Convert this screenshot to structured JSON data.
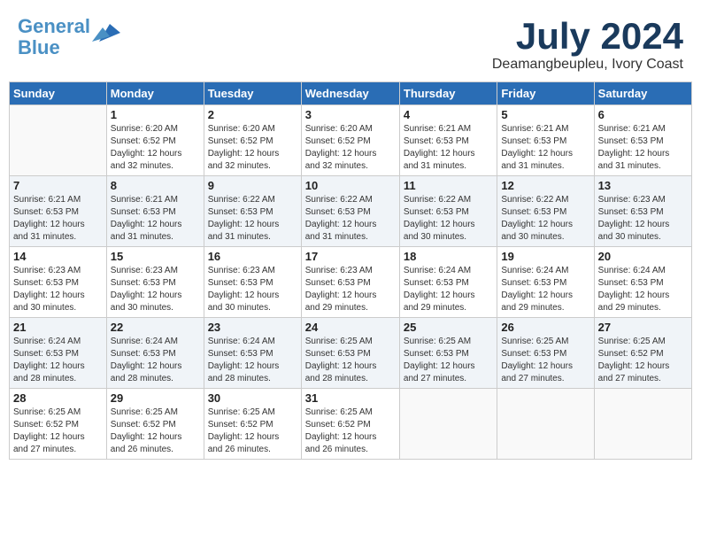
{
  "header": {
    "logo_line1": "General",
    "logo_line2": "Blue",
    "month": "July 2024",
    "location": "Deamangbeupleu, Ivory Coast"
  },
  "weekdays": [
    "Sunday",
    "Monday",
    "Tuesday",
    "Wednesday",
    "Thursday",
    "Friday",
    "Saturday"
  ],
  "weeks": [
    [
      {
        "day": "",
        "info": ""
      },
      {
        "day": "1",
        "info": "Sunrise: 6:20 AM\nSunset: 6:52 PM\nDaylight: 12 hours\nand 32 minutes."
      },
      {
        "day": "2",
        "info": "Sunrise: 6:20 AM\nSunset: 6:52 PM\nDaylight: 12 hours\nand 32 minutes."
      },
      {
        "day": "3",
        "info": "Sunrise: 6:20 AM\nSunset: 6:52 PM\nDaylight: 12 hours\nand 32 minutes."
      },
      {
        "day": "4",
        "info": "Sunrise: 6:21 AM\nSunset: 6:53 PM\nDaylight: 12 hours\nand 31 minutes."
      },
      {
        "day": "5",
        "info": "Sunrise: 6:21 AM\nSunset: 6:53 PM\nDaylight: 12 hours\nand 31 minutes."
      },
      {
        "day": "6",
        "info": "Sunrise: 6:21 AM\nSunset: 6:53 PM\nDaylight: 12 hours\nand 31 minutes."
      }
    ],
    [
      {
        "day": "7",
        "info": "Sunrise: 6:21 AM\nSunset: 6:53 PM\nDaylight: 12 hours\nand 31 minutes."
      },
      {
        "day": "8",
        "info": "Sunrise: 6:21 AM\nSunset: 6:53 PM\nDaylight: 12 hours\nand 31 minutes."
      },
      {
        "day": "9",
        "info": "Sunrise: 6:22 AM\nSunset: 6:53 PM\nDaylight: 12 hours\nand 31 minutes."
      },
      {
        "day": "10",
        "info": "Sunrise: 6:22 AM\nSunset: 6:53 PM\nDaylight: 12 hours\nand 31 minutes."
      },
      {
        "day": "11",
        "info": "Sunrise: 6:22 AM\nSunset: 6:53 PM\nDaylight: 12 hours\nand 30 minutes."
      },
      {
        "day": "12",
        "info": "Sunrise: 6:22 AM\nSunset: 6:53 PM\nDaylight: 12 hours\nand 30 minutes."
      },
      {
        "day": "13",
        "info": "Sunrise: 6:23 AM\nSunset: 6:53 PM\nDaylight: 12 hours\nand 30 minutes."
      }
    ],
    [
      {
        "day": "14",
        "info": "Sunrise: 6:23 AM\nSunset: 6:53 PM\nDaylight: 12 hours\nand 30 minutes."
      },
      {
        "day": "15",
        "info": "Sunrise: 6:23 AM\nSunset: 6:53 PM\nDaylight: 12 hours\nand 30 minutes."
      },
      {
        "day": "16",
        "info": "Sunrise: 6:23 AM\nSunset: 6:53 PM\nDaylight: 12 hours\nand 30 minutes."
      },
      {
        "day": "17",
        "info": "Sunrise: 6:23 AM\nSunset: 6:53 PM\nDaylight: 12 hours\nand 29 minutes."
      },
      {
        "day": "18",
        "info": "Sunrise: 6:24 AM\nSunset: 6:53 PM\nDaylight: 12 hours\nand 29 minutes."
      },
      {
        "day": "19",
        "info": "Sunrise: 6:24 AM\nSunset: 6:53 PM\nDaylight: 12 hours\nand 29 minutes."
      },
      {
        "day": "20",
        "info": "Sunrise: 6:24 AM\nSunset: 6:53 PM\nDaylight: 12 hours\nand 29 minutes."
      }
    ],
    [
      {
        "day": "21",
        "info": "Sunrise: 6:24 AM\nSunset: 6:53 PM\nDaylight: 12 hours\nand 28 minutes."
      },
      {
        "day": "22",
        "info": "Sunrise: 6:24 AM\nSunset: 6:53 PM\nDaylight: 12 hours\nand 28 minutes."
      },
      {
        "day": "23",
        "info": "Sunrise: 6:24 AM\nSunset: 6:53 PM\nDaylight: 12 hours\nand 28 minutes."
      },
      {
        "day": "24",
        "info": "Sunrise: 6:25 AM\nSunset: 6:53 PM\nDaylight: 12 hours\nand 28 minutes."
      },
      {
        "day": "25",
        "info": "Sunrise: 6:25 AM\nSunset: 6:53 PM\nDaylight: 12 hours\nand 27 minutes."
      },
      {
        "day": "26",
        "info": "Sunrise: 6:25 AM\nSunset: 6:53 PM\nDaylight: 12 hours\nand 27 minutes."
      },
      {
        "day": "27",
        "info": "Sunrise: 6:25 AM\nSunset: 6:52 PM\nDaylight: 12 hours\nand 27 minutes."
      }
    ],
    [
      {
        "day": "28",
        "info": "Sunrise: 6:25 AM\nSunset: 6:52 PM\nDaylight: 12 hours\nand 27 minutes."
      },
      {
        "day": "29",
        "info": "Sunrise: 6:25 AM\nSunset: 6:52 PM\nDaylight: 12 hours\nand 26 minutes."
      },
      {
        "day": "30",
        "info": "Sunrise: 6:25 AM\nSunset: 6:52 PM\nDaylight: 12 hours\nand 26 minutes."
      },
      {
        "day": "31",
        "info": "Sunrise: 6:25 AM\nSunset: 6:52 PM\nDaylight: 12 hours\nand 26 minutes."
      },
      {
        "day": "",
        "info": ""
      },
      {
        "day": "",
        "info": ""
      },
      {
        "day": "",
        "info": ""
      }
    ]
  ]
}
